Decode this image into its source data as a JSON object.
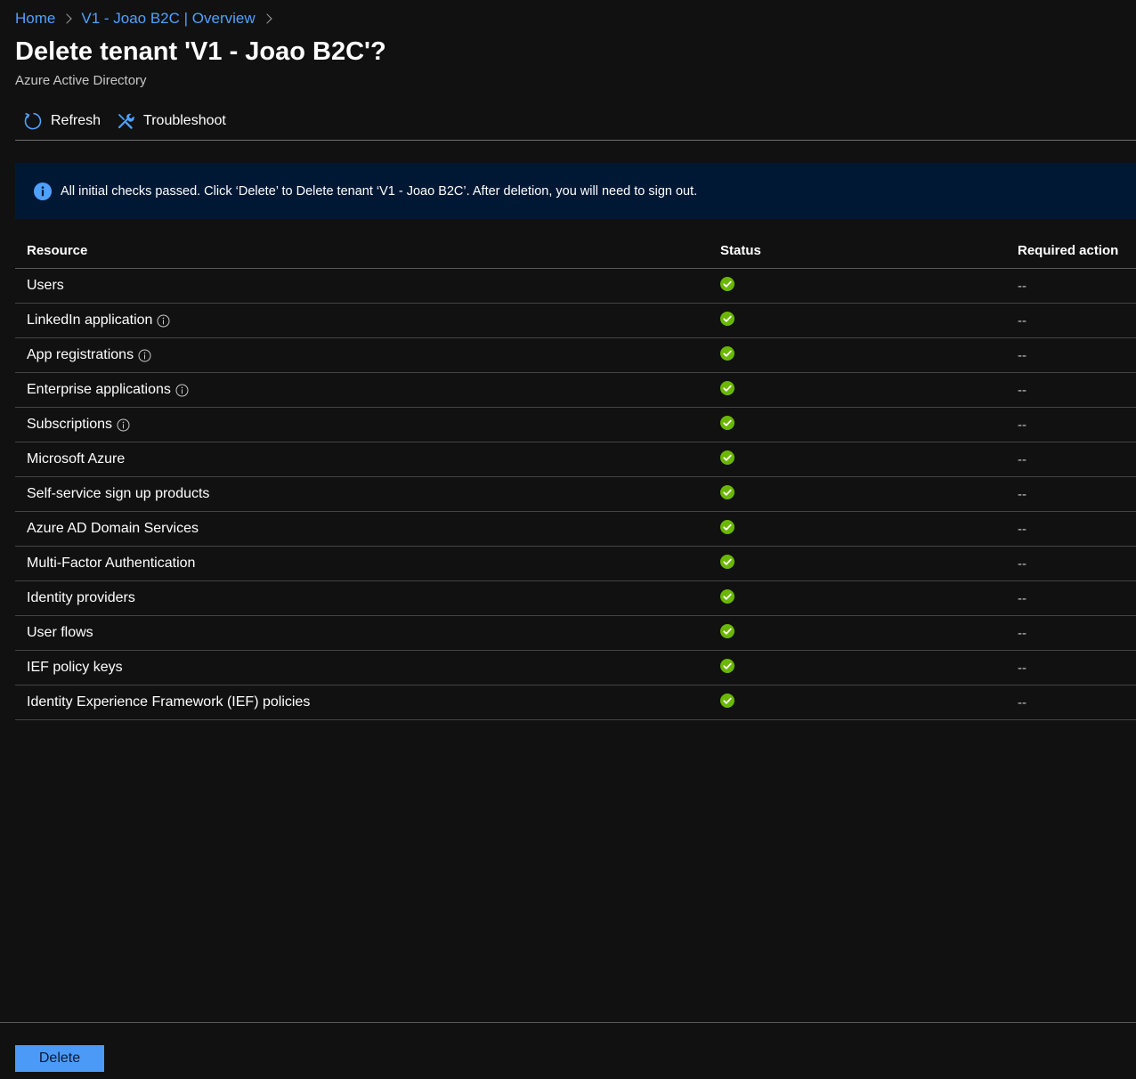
{
  "breadcrumb": {
    "home": "Home",
    "resource": "V1 - Joao B2C | Overview"
  },
  "header": {
    "title": "Delete tenant 'V1 - Joao B2C'?",
    "subtitle": "Azure Active Directory"
  },
  "toolbar": {
    "refresh_label": "Refresh",
    "troubleshoot_label": "Troubleshoot"
  },
  "banner": {
    "message": "All initial checks passed. Click ‘Delete’ to Delete tenant ‘V1 - Joao B2C’. After deletion, you will need to sign out."
  },
  "table": {
    "columns": {
      "resource": "Resource",
      "status": "Status",
      "action": "Required action"
    },
    "rows": [
      {
        "resource": "Users",
        "info": false,
        "status": "passed",
        "action": "--"
      },
      {
        "resource": "LinkedIn application",
        "info": true,
        "status": "passed",
        "action": "--"
      },
      {
        "resource": "App registrations",
        "info": true,
        "status": "passed",
        "action": "--"
      },
      {
        "resource": "Enterprise applications",
        "info": true,
        "status": "passed",
        "action": "--"
      },
      {
        "resource": "Subscriptions",
        "info": true,
        "status": "passed",
        "action": "--"
      },
      {
        "resource": "Microsoft Azure",
        "info": false,
        "status": "passed",
        "action": "--"
      },
      {
        "resource": "Self-service sign up products",
        "info": false,
        "status": "passed",
        "action": "--"
      },
      {
        "resource": "Azure AD Domain Services",
        "info": false,
        "status": "passed",
        "action": "--"
      },
      {
        "resource": "Multi-Factor Authentication",
        "info": false,
        "status": "passed",
        "action": "--"
      },
      {
        "resource": "Identity providers",
        "info": false,
        "status": "passed",
        "action": "--"
      },
      {
        "resource": "User flows",
        "info": false,
        "status": "passed",
        "action": "--"
      },
      {
        "resource": "IEF policy keys",
        "info": false,
        "status": "passed",
        "action": "--"
      },
      {
        "resource": "Identity Experience Framework (IEF) policies",
        "info": false,
        "status": "passed",
        "action": "--"
      }
    ]
  },
  "footer": {
    "delete_label": "Delete"
  },
  "colors": {
    "background": "#111111",
    "link": "#4ea1ff",
    "banner": "#011835",
    "success": "#6bb700",
    "primary_button": "#4b9af7"
  },
  "icons": {
    "refresh": "refresh-icon",
    "troubleshoot": "wrench-icon",
    "info": "info-icon",
    "status": "check-circle-icon",
    "breadcrumb_separator": "chevron-right-icon"
  }
}
